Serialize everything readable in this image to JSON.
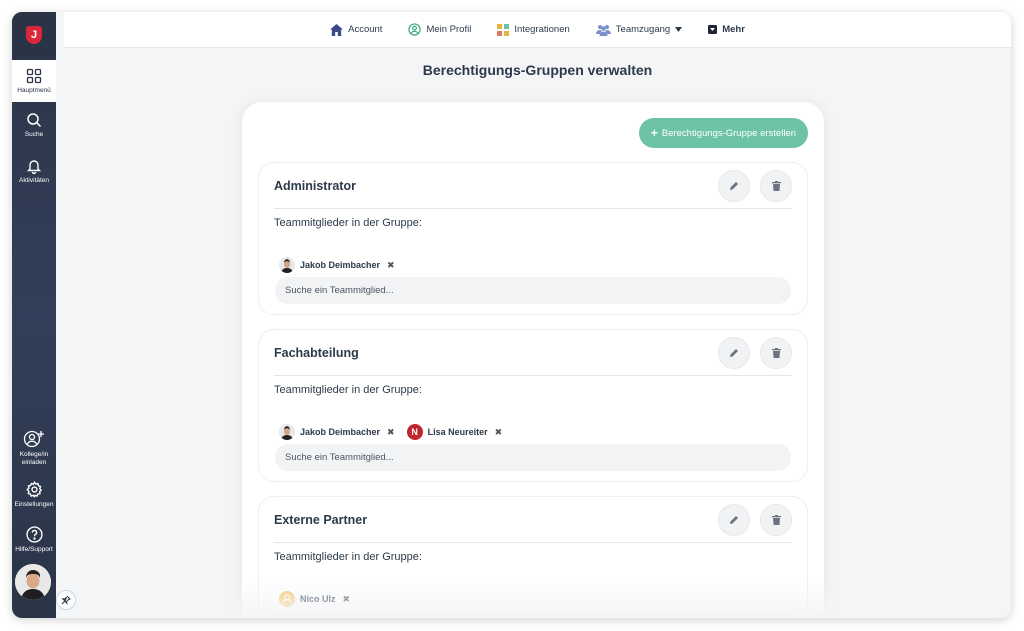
{
  "sidebar": {
    "logo_letter": "J",
    "items": [
      {
        "label": "Hauptmenü",
        "icon": "grid-icon"
      },
      {
        "label": "Suche",
        "icon": "search-icon"
      },
      {
        "label": "Aktivitäten",
        "icon": "bell-icon"
      },
      {
        "label": "Kollege/in einladen",
        "icon": "add-user-icon"
      },
      {
        "label": "Einstellungen",
        "icon": "gear-icon"
      },
      {
        "label": "Hilfe/Support",
        "icon": "help-icon"
      }
    ]
  },
  "topnav": {
    "account": "Account",
    "profile": "Mein Profil",
    "integrations": "Integrationen",
    "team": "Teamzugang",
    "more": "Mehr"
  },
  "page": {
    "title": "Berechtigungs-Gruppen verwalten",
    "create_label": "Berechtigungs-Gruppe erstellen",
    "members_label": "Teammitglieder in der Gruppe:",
    "search_placeholder": "Suche ein Teammitglied..."
  },
  "groups": [
    {
      "name": "Administrator",
      "members": [
        {
          "name": "Jakob Deimbacher",
          "avatar": "photo"
        }
      ]
    },
    {
      "name": "Fachabteilung",
      "members": [
        {
          "name": "Jakob Deimbacher",
          "avatar": "photo"
        },
        {
          "name": "Lisa Neureiter",
          "avatar": "initial",
          "initial": "N"
        }
      ]
    },
    {
      "name": "Externe Partner",
      "members": [
        {
          "name": "Nico Ulz",
          "avatar": "placeholder"
        }
      ]
    }
  ],
  "colors": {
    "accent": "#6cc4a4",
    "sidebar": "#2b3447",
    "brand": "#d8283a",
    "initial_avatar": "#c0272d"
  }
}
